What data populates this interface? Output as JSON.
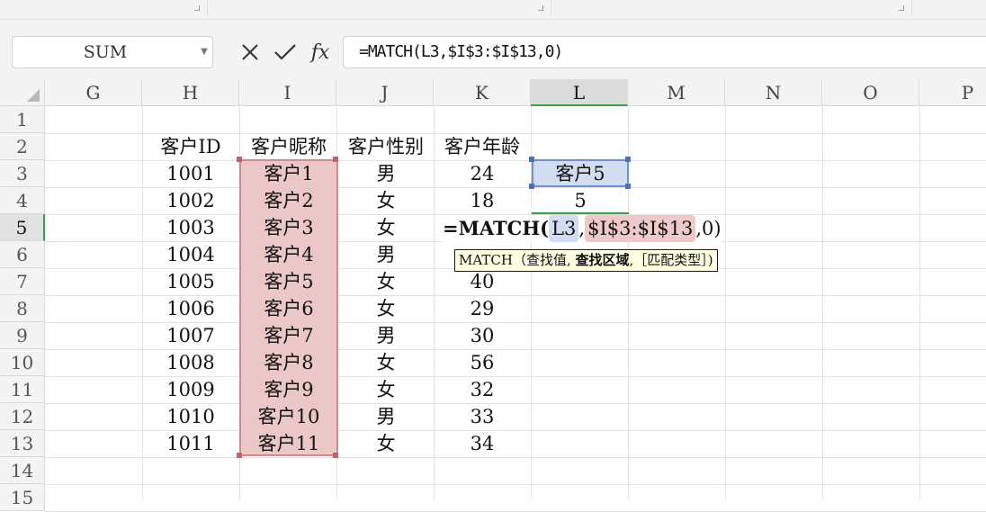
{
  "formula_bar": {
    "name_box": "SUM",
    "cancel_icon": "close-icon",
    "enter_icon": "check-icon",
    "fx_label": "fx",
    "formula": "=MATCH(L3,$I$3:$I$13,0)"
  },
  "columns": [
    "G",
    "H",
    "I",
    "J",
    "K",
    "L",
    "M",
    "N",
    "O",
    "P"
  ],
  "active_column": "L",
  "rows": [
    "1",
    "2",
    "3",
    "4",
    "5",
    "6",
    "7",
    "8",
    "9",
    "10",
    "11",
    "12",
    "13",
    "14",
    "15"
  ],
  "active_row": "5",
  "table": {
    "headers": [
      "客户ID",
      "客户昵称",
      "客户性别",
      "客户年龄"
    ],
    "records": [
      {
        "id": "1001",
        "name": "客户1",
        "gender": "男",
        "age": "24"
      },
      {
        "id": "1002",
        "name": "客户2",
        "gender": "女",
        "age": "18"
      },
      {
        "id": "1003",
        "name": "客户3",
        "gender": "女",
        "age": ""
      },
      {
        "id": "1004",
        "name": "客户4",
        "gender": "男",
        "age": ""
      },
      {
        "id": "1005",
        "name": "客户5",
        "gender": "女",
        "age": "40"
      },
      {
        "id": "1006",
        "name": "客户6",
        "gender": "女",
        "age": "29"
      },
      {
        "id": "1007",
        "name": "客户7",
        "gender": "男",
        "age": "30"
      },
      {
        "id": "1008",
        "name": "客户8",
        "gender": "女",
        "age": "56"
      },
      {
        "id": "1009",
        "name": "客户9",
        "gender": "女",
        "age": "32"
      },
      {
        "id": "1010",
        "name": "客户10",
        "gender": "男",
        "age": "33"
      },
      {
        "id": "1011",
        "name": "客户11",
        "gender": "女",
        "age": "34"
      }
    ]
  },
  "lookup": {
    "l3_value": "客户5",
    "l4_value": "5"
  },
  "editing": {
    "prefix": "=MATCH(",
    "ref1": "L3",
    "sep1": ",",
    "ref2": "$I$3:$I$13",
    "suffix": ",0)"
  },
  "tooltip": {
    "func": "MATCH",
    "open": "（",
    "arg1": "查找值,",
    "arg2": "查找区域",
    "arg3": ",［匹配类型］)"
  }
}
